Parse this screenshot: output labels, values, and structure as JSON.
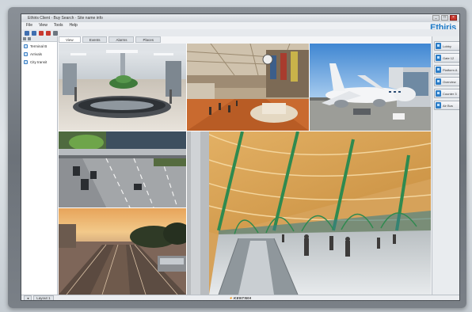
{
  "window": {
    "title": "Ethiris Client · Buy Search · Site name info",
    "controls": [
      "_",
      "□",
      "×"
    ]
  },
  "menu": [
    "File",
    "View",
    "Tools",
    "Help"
  ],
  "brand": "Ethiris",
  "toolbar_icons": [
    {
      "name": "new-icon",
      "color": "#3f6fb0"
    },
    {
      "name": "open-icon",
      "color": "#3f6fb0"
    },
    {
      "name": "record-icon",
      "color": "#c8392f"
    },
    {
      "name": "stop-icon",
      "color": "#c8392f"
    },
    {
      "name": "settings-icon",
      "color": "#6c7680"
    }
  ],
  "tabs": [
    {
      "label": "View",
      "active": true
    },
    {
      "label": "Events",
      "active": false
    },
    {
      "label": "Alarms",
      "active": false
    },
    {
      "label": "Places",
      "active": false
    }
  ],
  "tree": [
    "Terminal B",
    "Arrivals",
    "City transit"
  ],
  "cameras": [
    {
      "name": "camera-baggage-claim"
    },
    {
      "name": "camera-concourse"
    },
    {
      "name": "camera-apron"
    },
    {
      "name": "camera-highway"
    },
    {
      "name": "camera-terminal-hall"
    },
    {
      "name": "camera-rail-sunset"
    }
  ],
  "right_panel": [
    "Lobby",
    "Gate 12",
    "Platform A",
    "Overview",
    "Counter 3",
    "Air Bus"
  ],
  "status": {
    "chips": [
      "◂",
      "Layout 1"
    ],
    "logo_mark": "✦",
    "logo": "KENTIMA"
  },
  "colors": {
    "accent": "#1d7ac7",
    "logo_mark": "#f08a00"
  }
}
